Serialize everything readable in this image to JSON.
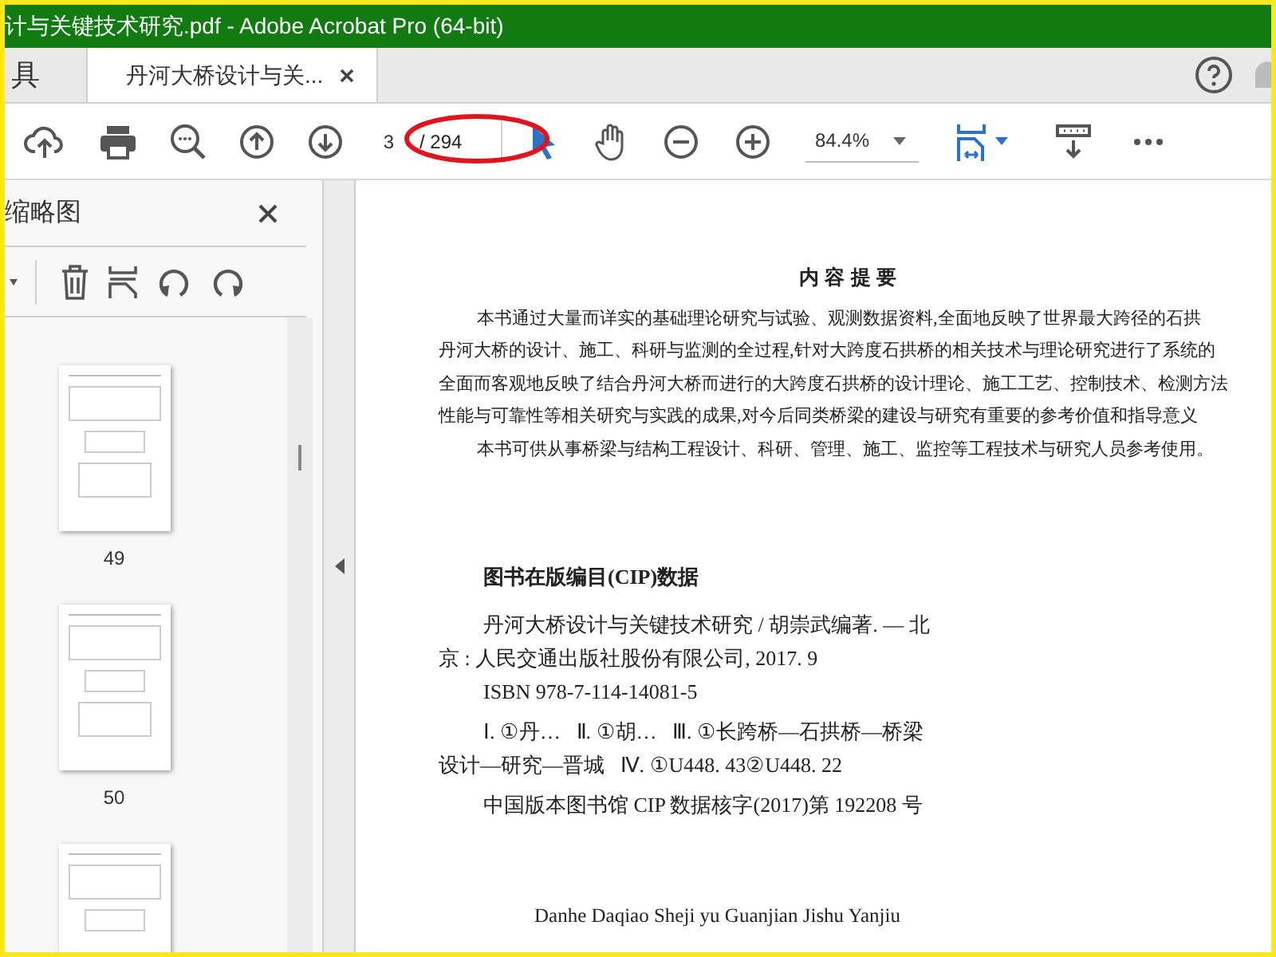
{
  "window": {
    "title": "计与关键技术研究.pdf - Adobe Acrobat Pro (64-bit)"
  },
  "tabs": [
    {
      "label": "具",
      "selected": false,
      "closable": false
    },
    {
      "label": "丹河大桥设计与关...",
      "selected": true,
      "closable": true
    }
  ],
  "toolbar": {
    "page_number": "3",
    "page_total": "/ 294",
    "zoom": "84.4%"
  },
  "sidebar": {
    "title": "缩略图",
    "thumbnails": [
      {
        "label": "49"
      },
      {
        "label": "50"
      }
    ]
  },
  "page": {
    "heading": "内 容 提 要",
    "paragraphs": [
      {
        "lines": [
          "本书通过大量而详实的基础理论研究与试验、观测数据资料,全面地反映了世界最大跨径的石拱",
          "丹河大桥的设计、施工、科研与监测的全过程,针对大跨度石拱桥的相关技术与理论研究进行了系统的",
          "全面而客观地反映了结合丹河大桥而进行的大跨度石拱桥的设计理论、施工工艺、控制技术、检测方法",
          "性能与可靠性等相关研究与实践的成果,对今后同类桥梁的建设与研究有重要的参考价值和指导意义"
        ]
      },
      {
        "lines": [
          "本书可供从事桥梁与结构工程设计、科研、管理、施工、监控等工程技术与研究人员参考使用。"
        ]
      }
    ],
    "cip_heading": "图书在版编目(CIP)数据",
    "cip_entries": [
      {
        "lines": [
          "丹河大桥设计与关键技术研究 / 胡崇武编著. — 北",
          "京 : 人民交通出版社股份有限公司, 2017. 9"
        ]
      },
      {
        "lines": [
          "ISBN 978-7-114-14081-5"
        ]
      },
      {
        "lines": [
          "Ⅰ. ①丹…   Ⅱ. ①胡…   Ⅲ. ①长跨桥—石拱桥—桥梁",
          "设计—研究—晋城   Ⅳ. ①U448. 43②U448. 22"
        ]
      },
      {
        "lines": [
          "中国版本图书馆 CIP 数据核字(2017)第 192208 号"
        ]
      }
    ],
    "pinyin_title": "Danhe Daqiao Sheji yu Guanjian Jishu Yanjiu"
  }
}
